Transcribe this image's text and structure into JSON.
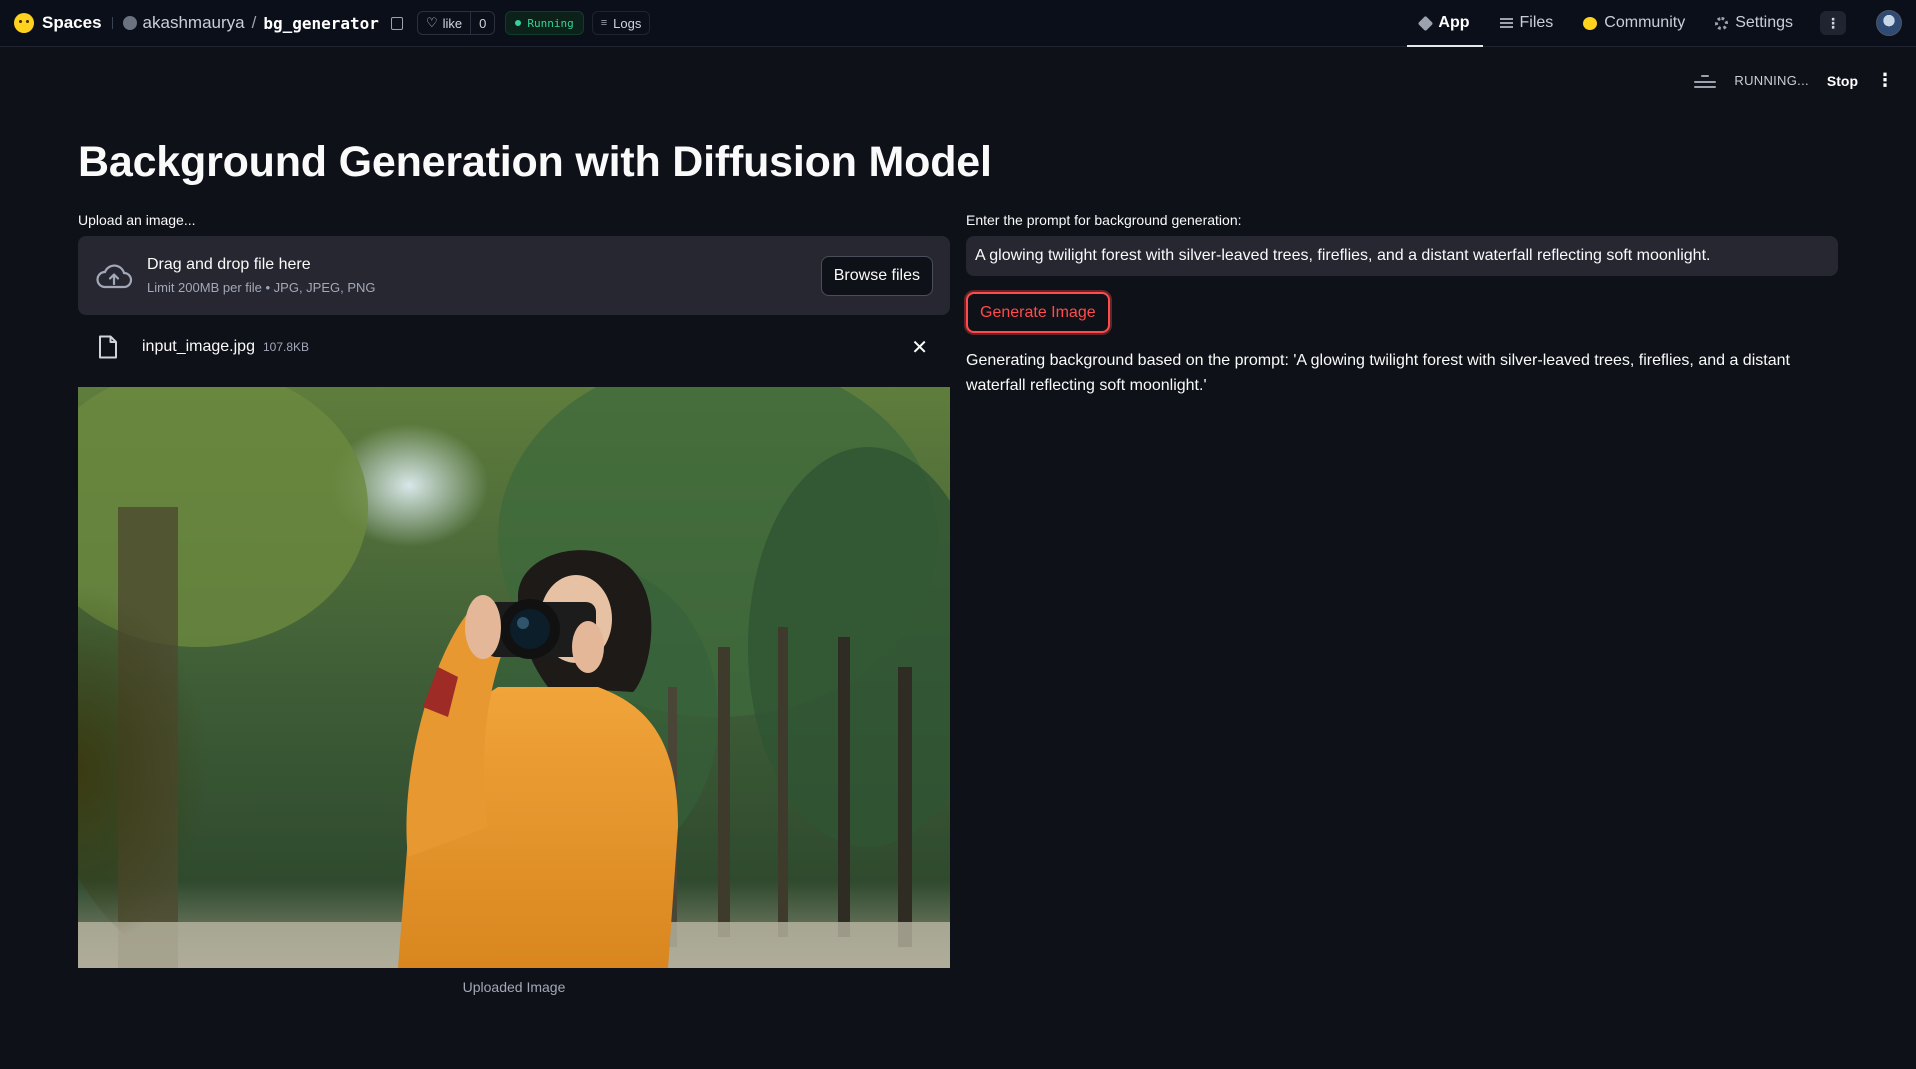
{
  "hf_header": {
    "brand": "Spaces",
    "owner": "akashmaurya",
    "repo_name": "bg_generator",
    "like_label": "like",
    "like_count": "0",
    "status": "Running",
    "logs_label": "Logs",
    "tabs": [
      {
        "label": "App",
        "icon": "cube-icon",
        "active": true
      },
      {
        "label": "Files",
        "icon": "files-icon",
        "active": false
      },
      {
        "label": "Community",
        "icon": "community-icon",
        "active": false
      },
      {
        "label": "Settings",
        "icon": "gear-icon",
        "active": false
      }
    ],
    "more_label": "⋮"
  },
  "st_toolbar": {
    "status": "RUNNING...",
    "stop_label": "Stop",
    "menu_label": "⋮"
  },
  "main": {
    "title": "Background Generation with Diffusion Model",
    "upload": {
      "label": "Upload an image...",
      "drag_text": "Drag and drop file here",
      "limit_text": "Limit 200MB per file • JPG, JPEG, PNG",
      "browse_label": "Browse files",
      "file_name": "input_image.jpg",
      "file_size": "107.8KB",
      "remove_label": "✕"
    },
    "image_caption": "Uploaded Image",
    "prompt": {
      "label": "Enter the prompt for background generation:",
      "value": "A glowing twilight forest with silver-leaved trees, fireflies, and a distant waterfall reflecting soft moonlight."
    },
    "generate_label": "Generate Image",
    "status_message": "Generating background based on the prompt: 'A glowing twilight forest with silver-leaved trees, fireflies, and a distant waterfall reflecting soft moonlight.'"
  },
  "colors": {
    "background": "#0e1117",
    "widget_bg": "#262730",
    "accent": "#ff4b4b",
    "status_green": "#34d399"
  }
}
